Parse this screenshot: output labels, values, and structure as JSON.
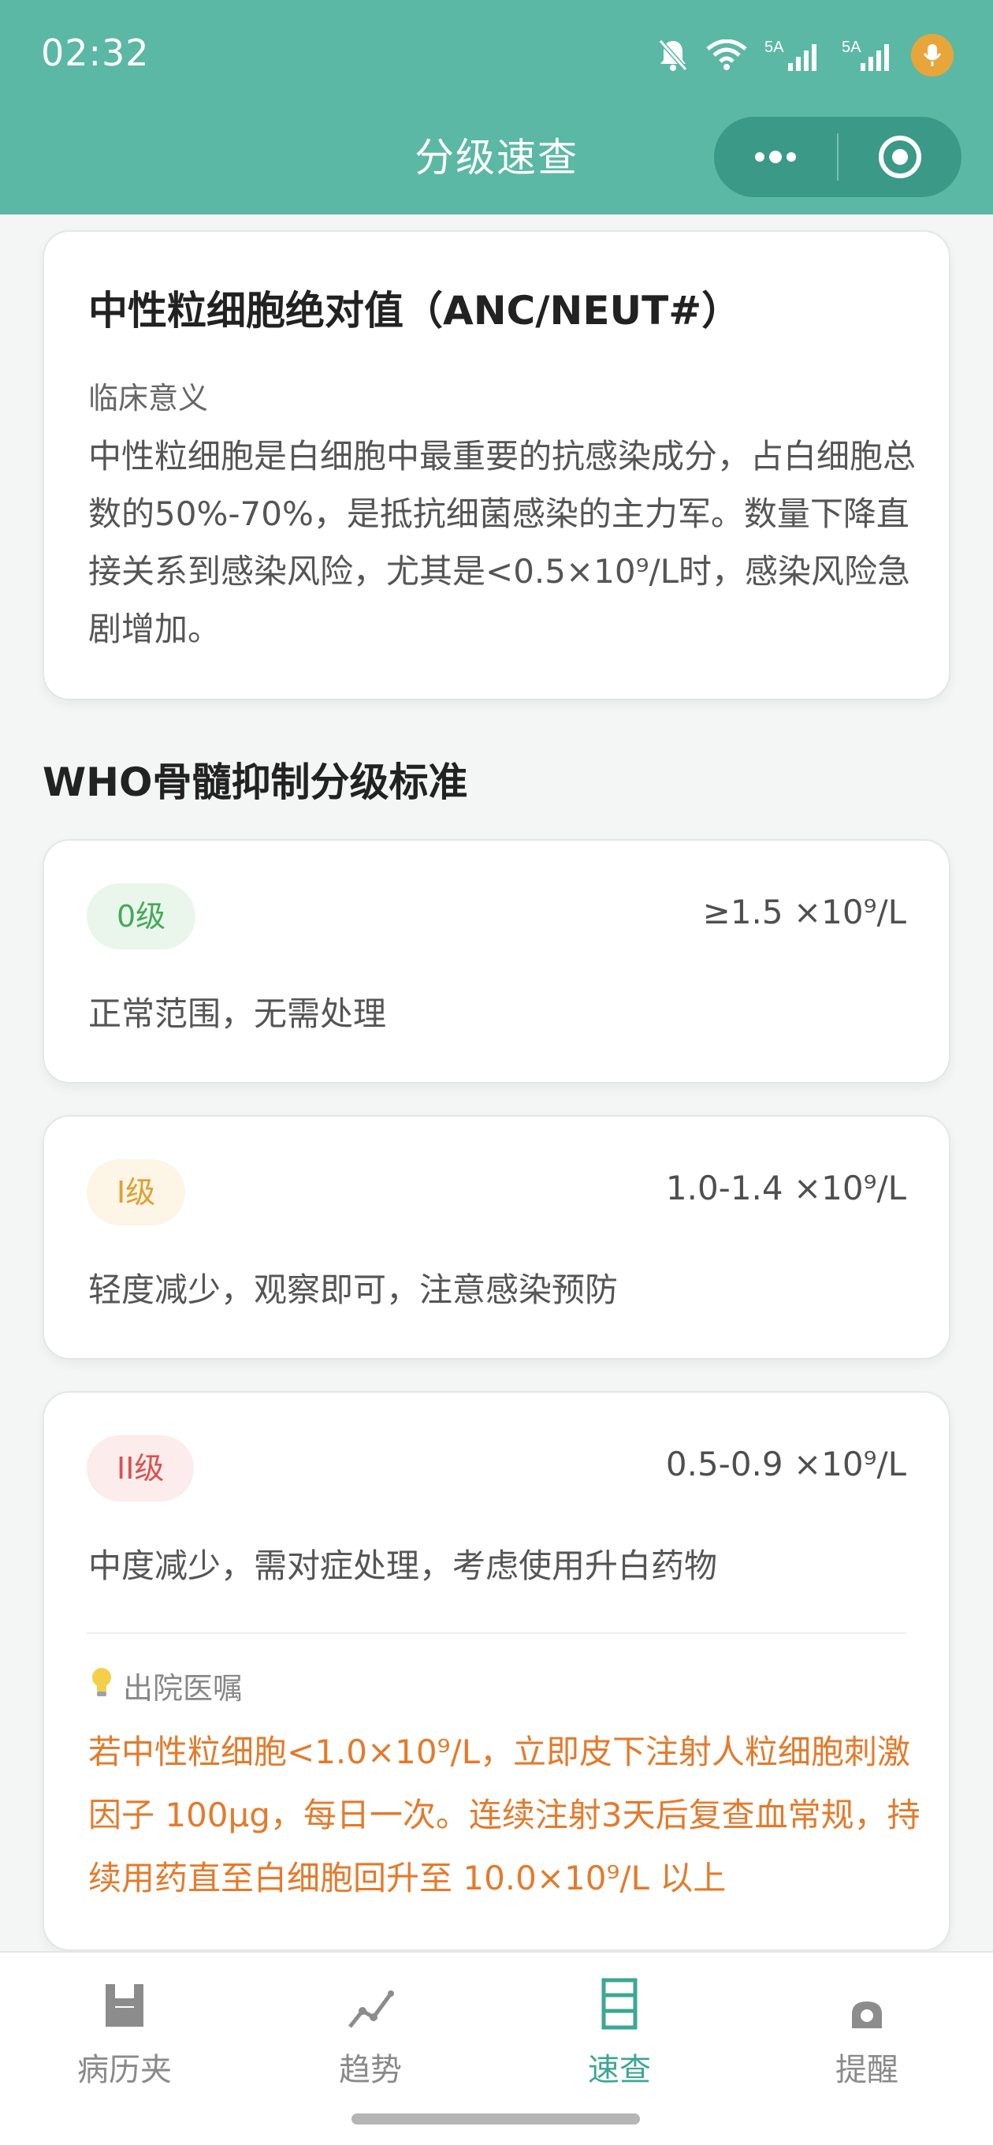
{
  "status_bar": {
    "time": "02:32",
    "icons": [
      "mute-bell-icon",
      "wifi-icon",
      "signal-5a-icon",
      "signal-5a-icon",
      "mic-icon"
    ],
    "mic_color": "#e8a53a"
  },
  "header": {
    "title": "分级速查",
    "bg_color": "#5bb8a5",
    "capsule_icons": [
      "more-icon",
      "close-target-icon"
    ]
  },
  "intro": {
    "title": "中性粒细胞绝对值（ANC/NEUT#）",
    "label": "临床意义",
    "body": "中性粒细胞是白细胞中最重要的抗感染成分，占白细胞总数的50%-70%，是抵抗细菌感染的主力军。数量下降直接关系到感染风险，尤其是<0.5×10⁹/L时，感染风险急剧增加。"
  },
  "section_title": "WHO骨髓抑制分级标准",
  "grades": [
    {
      "badge": "0级",
      "range": "≥1.5 ×10⁹/L",
      "description": "正常范围，无需处理",
      "color": "#45a95a"
    },
    {
      "badge": "I级",
      "range": "1.0-1.4 ×10⁹/L",
      "description": "轻度减少，观察即可，注意感染预防",
      "color": "#e0a030"
    },
    {
      "badge": "II级",
      "range": "0.5-0.9 ×10⁹/L",
      "description": "中度减少，需对症处理，考虑使用升白药物",
      "color": "#d5544f",
      "advice_label": "出院医嘱",
      "advice_icon": "lightbulb-icon",
      "advice": "若中性粒细胞<1.0×10⁹/L，立即皮下注射人粒细胞刺激因子 100μg，每日一次。连续注射3天后复查血常规，持续用药直至白细胞回升至 10.0×10⁹/L 以上"
    }
  ],
  "tabbar": {
    "active_color": "#3ea693",
    "tabs": [
      {
        "label": "病历夹",
        "icon": "folder-icon"
      },
      {
        "label": "趋势",
        "icon": "trend-icon"
      },
      {
        "label": "速查",
        "icon": "list-icon",
        "active": true
      },
      {
        "label": "提醒",
        "icon": "bell-icon"
      }
    ]
  }
}
